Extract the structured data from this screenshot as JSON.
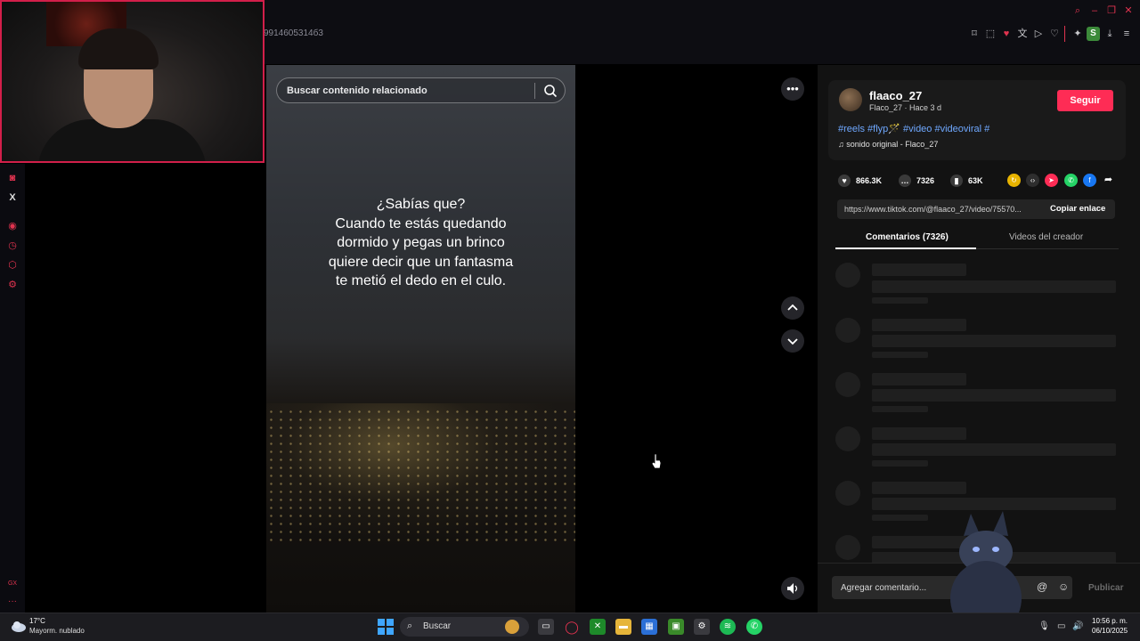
{
  "browser": {
    "url_fragment": "9914605314б3",
    "window_controls": [
      "search-icon",
      "minimize-icon",
      "restore-icon",
      "close-icon"
    ],
    "toolbar_icons": [
      "bookmark-icon",
      "screenshot-icon",
      "pocket-icon",
      "translate-icon",
      "play-icon",
      "heart-icon",
      "extensions-icon",
      "profile-icon",
      "download-icon",
      "menu-icon"
    ],
    "profile_letter": "S"
  },
  "sidebar": {
    "icons": [
      "instagram-icon",
      "x-icon",
      "player-icon",
      "history-icon",
      "extensions-icon",
      "settings-icon"
    ],
    "bottom_label": "GX",
    "x_label": "X"
  },
  "video": {
    "search_placeholder": "Buscar contenido relacionado",
    "caption_lines": [
      "¿Sabías que?",
      "Cuando te estás quedando",
      "dormido y pegas un brinco",
      "quiere decir que un fantasma",
      "te metió el dedo en el culo."
    ]
  },
  "controls": {
    "more": "•••",
    "up": "⌃",
    "down": "⌄",
    "volume": "🔊"
  },
  "post": {
    "author": "flaaco_27",
    "author_sub": "Flaco_27 · Hace 3 d",
    "follow_label": "Seguir",
    "hashtags": "#reels #flyp🪄 #video #videoviral #",
    "sound": "sonido original - Flaco_27",
    "likes": "866.3K",
    "comments": "7326",
    "saves": "63K",
    "link_url": "https://www.tiktok.com/@flaaco_27/video/75570...",
    "copy_link_label": "Copiar enlace",
    "tabs": [
      "Comentarios (7326)",
      "Videos del creador"
    ],
    "active_tab": 0,
    "comment_placeholder": "Agregar comentario...",
    "publish_label": "Publicar"
  },
  "taskbar": {
    "weather_temp": "17°C",
    "weather_desc": "Mayorm. nublado",
    "search_label": "Buscar",
    "time": "10:56 p. m.",
    "date": "06/10/2025"
  },
  "colors": {
    "accent": "#fe2c55",
    "gx_red": "#e0334f",
    "hashtag": "#6fa8ff"
  }
}
